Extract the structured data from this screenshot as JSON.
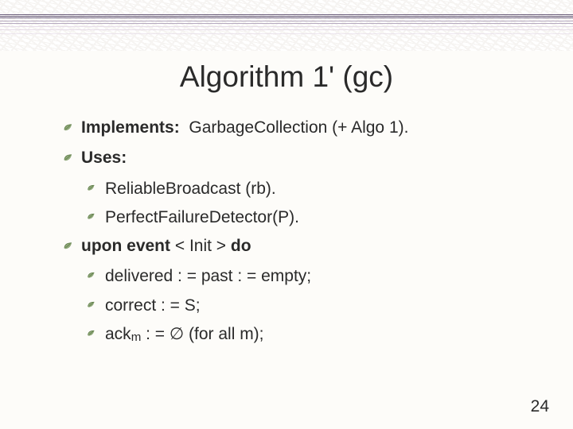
{
  "title": "Algorithm 1' (gc)",
  "lines": {
    "implements_label": "Implements:",
    "implements_value": "GarbageCollection (+ Algo 1).",
    "uses_label": "Uses:",
    "uses_items": [
      "ReliableBroadcast (rb).",
      "PerfectFailureDetector(P)."
    ],
    "upon_a": "upon event",
    "upon_mid": " < Init > ",
    "upon_b": "do",
    "body": [
      "delivered : = past : = empty;",
      "correct : = S;"
    ],
    "ack_pre": "ack",
    "ack_sub": "m",
    "ack_post": " : = ∅ (for all m);"
  },
  "page_number": "24"
}
